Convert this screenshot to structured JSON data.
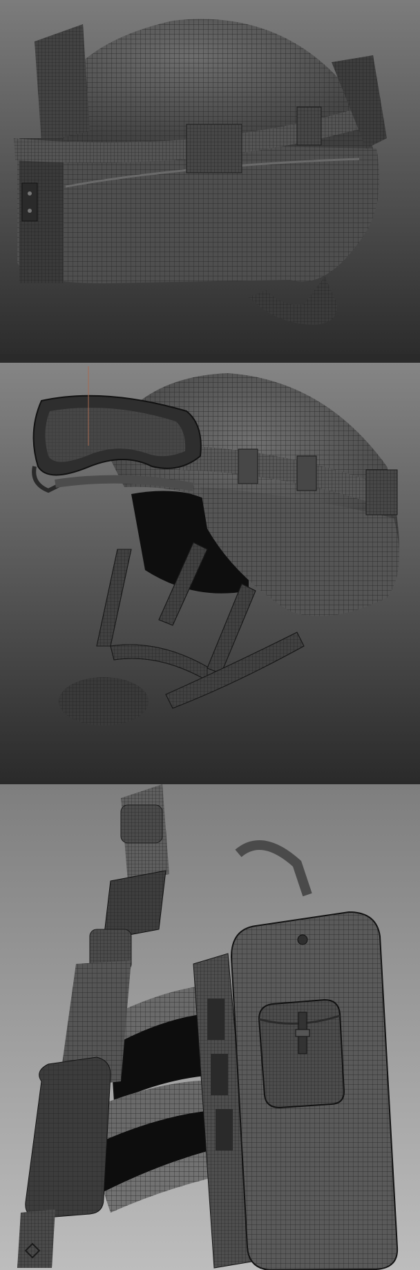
{
  "gallery": {
    "panels": [
      {
        "subject": "helmet-side-view"
      },
      {
        "subject": "helmet-with-goggles"
      },
      {
        "subject": "leg-holster-rig"
      }
    ]
  },
  "colors": {
    "bg_top": "#7a7a7a",
    "bg_bottom": "#2b2b2b",
    "mesh_fill": "#5a5a5a",
    "mesh_dark": "#3e3e3e",
    "wire": "#1e1e1e",
    "highlight": "#8a8a8a",
    "void": "#0d0d0d"
  }
}
